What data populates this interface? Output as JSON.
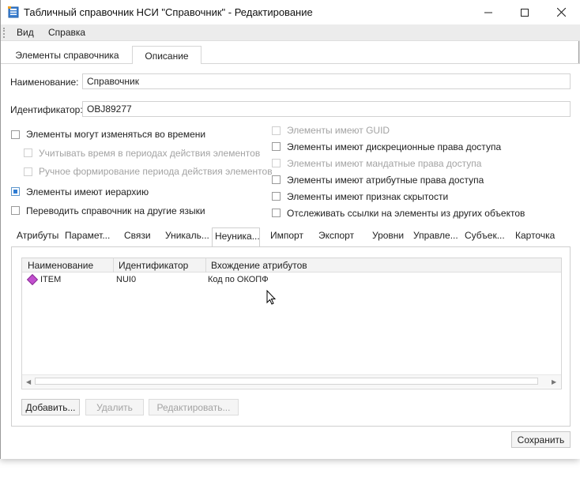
{
  "window": {
    "title": "Табличный справочник НСИ \"Справочник\" - Редактирование",
    "controls": {
      "minimize": "minimize-icon",
      "maximize": "maximize-icon",
      "close": "close-icon"
    }
  },
  "menu": {
    "items": [
      "Вид",
      "Справка"
    ]
  },
  "main_tabs": [
    {
      "label": "Элементы справочника",
      "active": false
    },
    {
      "label": "Описание",
      "active": true
    }
  ],
  "form": {
    "name_label": "Наименование:",
    "name_value": "Справочник",
    "id_label": "Идентификатор:",
    "id_value": "OBJ89277"
  },
  "left_options": [
    {
      "label": "Элементы могут изменяться во времени",
      "checked": false,
      "disabled": false
    },
    {
      "label": "Учитывать время в периодах действия элементов",
      "checked": false,
      "disabled": true
    },
    {
      "label": "Ручное формирование периода действия элементов",
      "checked": false,
      "disabled": true
    },
    {
      "label": "Элементы имеют иерархию",
      "checked": true,
      "disabled": false
    },
    {
      "label": "Переводить справочник на другие языки",
      "checked": false,
      "disabled": false
    }
  ],
  "right_options": [
    {
      "label": "Элементы имеют GUID",
      "checked": false,
      "disabled": true
    },
    {
      "label": "Элементы имеют дискреционные права доступа",
      "checked": false,
      "disabled": false
    },
    {
      "label": "Элементы имеют мандатные права доступа",
      "checked": false,
      "disabled": true
    },
    {
      "label": "Элементы имеют атрибутные права доступа",
      "checked": false,
      "disabled": false
    },
    {
      "label": "Элементы имеют признак скрытости",
      "checked": false,
      "disabled": false
    },
    {
      "label": "Отслеживать ссылки на элементы из других объектов",
      "checked": false,
      "disabled": false
    }
  ],
  "sub_tabs": [
    {
      "label": "Атрибуты",
      "active": false
    },
    {
      "label": "Парамет...",
      "active": false
    },
    {
      "label": "Связи",
      "active": false
    },
    {
      "label": "Уникаль...",
      "active": false
    },
    {
      "label": "Неуника...",
      "active": true
    },
    {
      "label": "Импорт",
      "active": false
    },
    {
      "label": "Экспорт",
      "active": false
    },
    {
      "label": "Уровни",
      "active": false
    },
    {
      "label": "Управле...",
      "active": false
    },
    {
      "label": "Субъек...",
      "active": false
    },
    {
      "label": "Карточка",
      "active": false
    }
  ],
  "grid": {
    "columns": [
      "Наименование",
      "Идентификатор",
      "Вхождение атрибутов"
    ],
    "rows": [
      {
        "icon": "diamond-icon",
        "name": "ITEM",
        "id": "NUI0",
        "attrs": "Код по ОКОПФ"
      }
    ]
  },
  "buttons": {
    "add": "Добавить...",
    "delete": "Удалить",
    "edit": "Редактировать...",
    "save": "Сохранить"
  },
  "colors": {
    "accent": "#2f7cd3",
    "diamond": "#c24fcf"
  }
}
